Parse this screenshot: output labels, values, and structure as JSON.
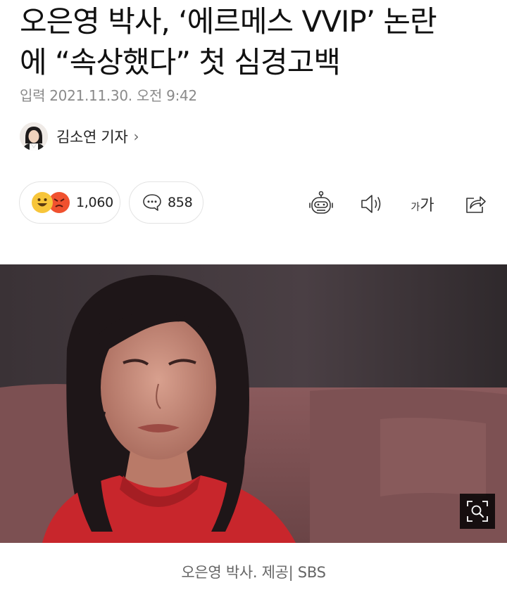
{
  "article": {
    "headline_line1": "오은영 박사, ‘에르메스 VVIP’ 논란",
    "headline_line2": "에 “속상했다” 첫 심경고백",
    "dateline": "입력 2021.11.30. 오전 9:42"
  },
  "reporter": {
    "name": "김소연 기자",
    "chevron": "›"
  },
  "actions": {
    "reaction_count": "1,060",
    "comment_count": "858",
    "font_size_label_small": "가",
    "font_size_label_large": "가"
  },
  "photo": {
    "caption": "오은영 박사. 제공| SBS"
  },
  "icons": [
    "smile-emoji-icon",
    "angry-emoji-icon",
    "comment-bubble-icon",
    "robot-summary-icon",
    "speaker-icon",
    "share-icon",
    "zoom-icon"
  ],
  "colors": {
    "reaction_yellow": "#f7c53a",
    "reaction_red": "#f0512f",
    "caption_gray": "#666666",
    "date_gray": "#8a8a8a"
  }
}
